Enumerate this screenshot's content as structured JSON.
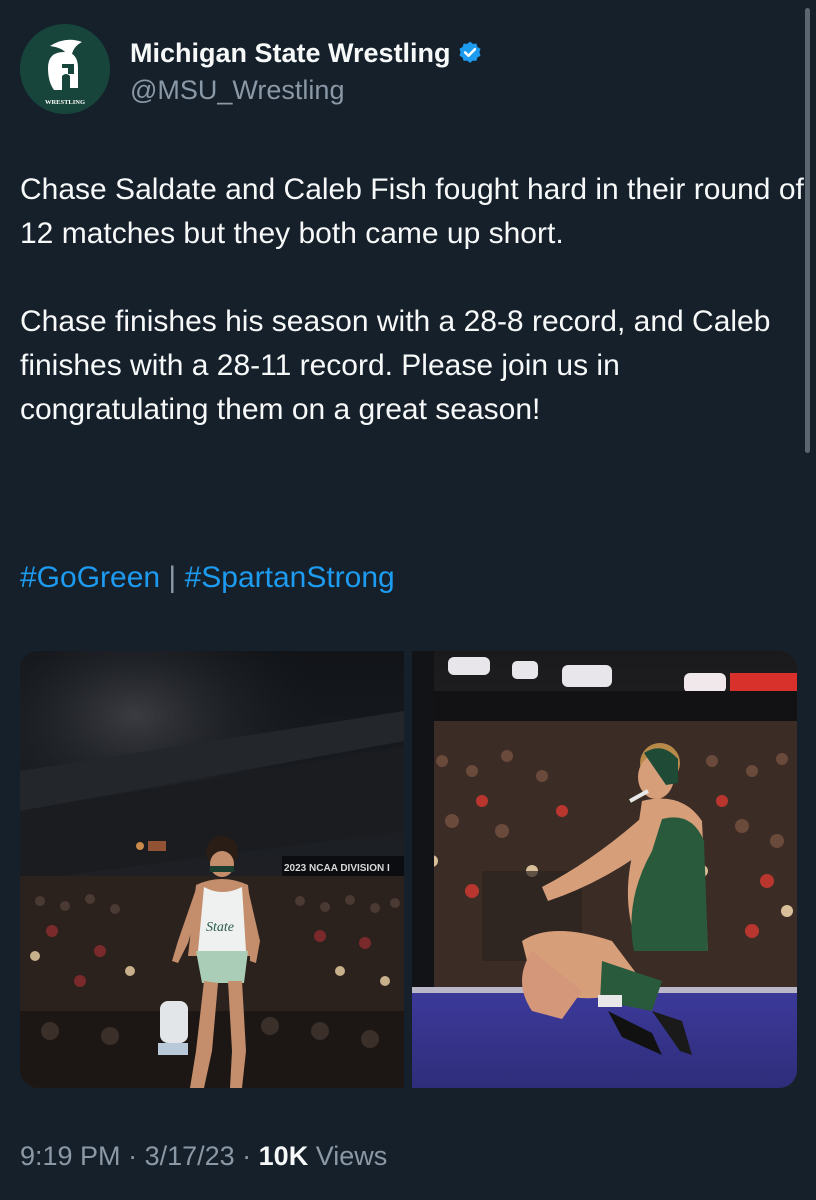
{
  "author": {
    "display_name": "Michigan State Wrestling",
    "handle": "@MSU_Wrestling",
    "avatar_text": "WRESTLING",
    "verified_icon": "verified-badge-icon"
  },
  "tweet": {
    "paragraph1": "Chase Saldate and Caleb Fish fought hard in their round of 12 matches but they both came up short.",
    "paragraph2": "Chase finishes his season with a 28-8 record, and Caleb finishes with a 28-11 record. Please join us in congratulating them on a great season!",
    "hashtag1": "#GoGreen",
    "separator": " | ",
    "hashtag2": "#SpartanStrong"
  },
  "media": {
    "left_banner_text": "2023 NCAA DIVISION I",
    "left_singlet_text": "State"
  },
  "meta": {
    "time": "9:19 PM",
    "dot1": " · ",
    "date": "3/17/23",
    "dot2": " · ",
    "views_count": "10K",
    "views_label": " Views"
  },
  "colors": {
    "background": "#15202b",
    "link": "#1d9bf0",
    "secondary_text": "#8b98a5",
    "msu_green": "#18453b"
  }
}
